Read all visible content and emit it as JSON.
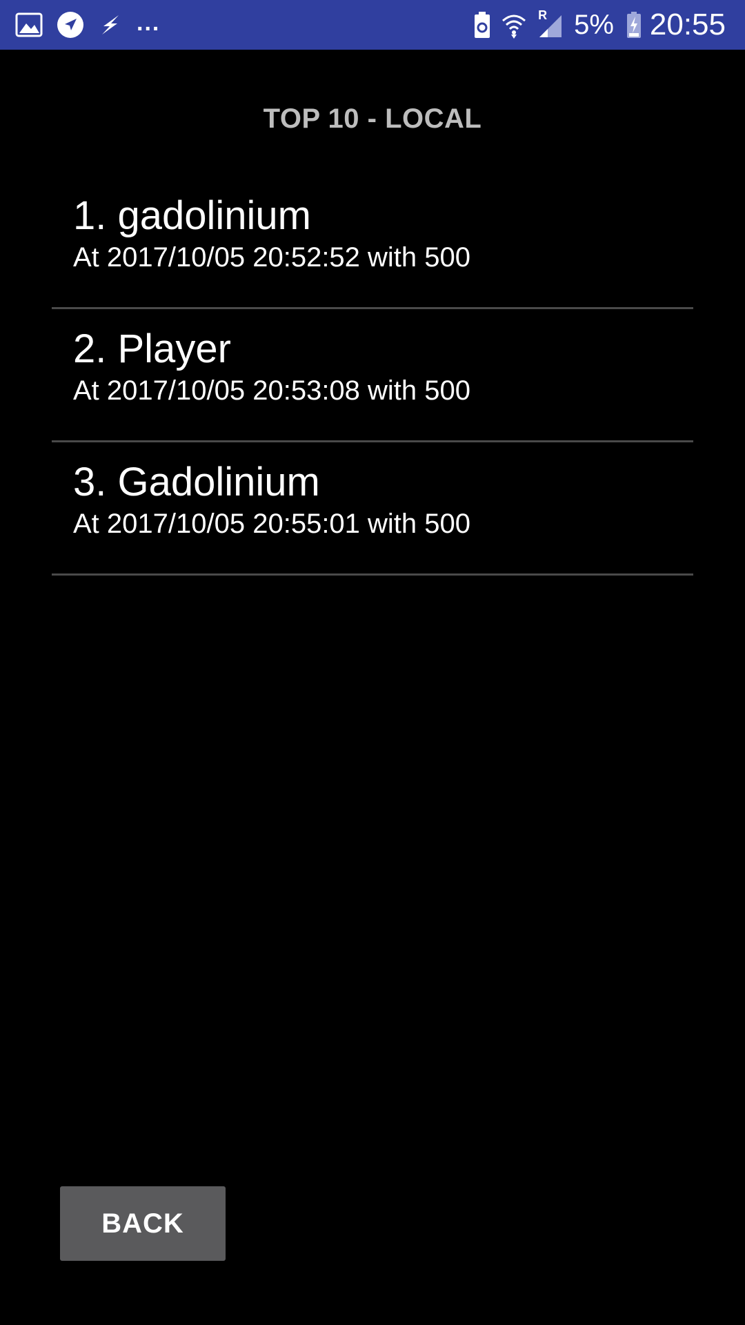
{
  "status_bar": {
    "left_icons": [
      "gallery-icon",
      "navigation-icon",
      "flash-icon"
    ],
    "overflow": "...",
    "right_icons": [
      "battery-saver-icon",
      "wifi-icon",
      "signal-icon",
      "battery-icon"
    ],
    "roaming_indicator": "R",
    "battery_percent": "5%",
    "time": "20:55",
    "background_color": "#303f9f"
  },
  "screen": {
    "title": "TOP 10 - LOCAL",
    "scores": [
      {
        "name": "1. gadolinium",
        "detail": "At 2017/10/05 20:52:52 with 500"
      },
      {
        "name": "2. Player",
        "detail": "At 2017/10/05 20:53:08 with 500"
      },
      {
        "name": "3. Gadolinium",
        "detail": "At 2017/10/05 20:55:01 with 500"
      }
    ],
    "back_label": "BACK"
  },
  "colors": {
    "background": "#000000",
    "title": "#bdbdbd",
    "divider": "#4a4a4a",
    "button": "#5a5a5c"
  }
}
